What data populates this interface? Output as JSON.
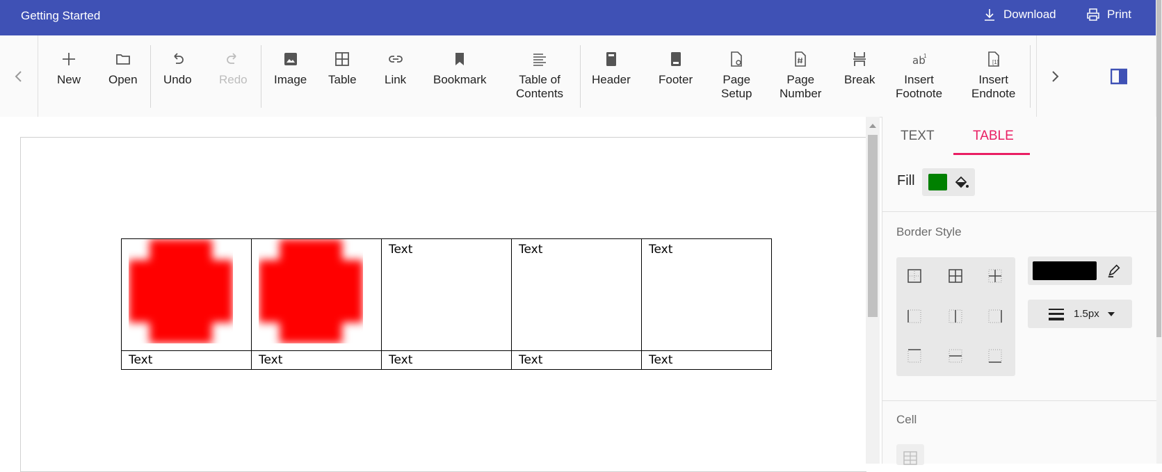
{
  "app": {
    "title": "Getting Started",
    "download_label": "Download",
    "print_label": "Print"
  },
  "toolbar": {
    "items": [
      {
        "label": "New",
        "icon": "plus-icon",
        "disabled": false
      },
      {
        "label": "Open",
        "icon": "folder-icon",
        "disabled": false
      },
      {
        "label": "Undo",
        "icon": "undo-icon",
        "disabled": false
      },
      {
        "label": "Redo",
        "icon": "redo-icon",
        "disabled": true
      },
      {
        "label": "Image",
        "icon": "image-icon",
        "disabled": false
      },
      {
        "label": "Table",
        "icon": "table-icon",
        "disabled": false
      },
      {
        "label": "Link",
        "icon": "link-icon",
        "disabled": false
      },
      {
        "label": "Bookmark",
        "icon": "bookmark-icon",
        "disabled": false
      },
      {
        "label": "Table of\nContents",
        "icon": "toc-icon",
        "disabled": false
      },
      {
        "label": "Header",
        "icon": "header-icon",
        "disabled": false
      },
      {
        "label": "Footer",
        "icon": "footer-icon",
        "disabled": false
      },
      {
        "label": "Page\nSetup",
        "icon": "page-setup-icon",
        "disabled": false
      },
      {
        "label": "Page\nNumber",
        "icon": "page-number-icon",
        "disabled": false
      },
      {
        "label": "Break",
        "icon": "break-icon",
        "disabled": false
      },
      {
        "label": "Insert\nFootnote",
        "icon": "footnote-icon",
        "disabled": false
      },
      {
        "label": "Insert\nEndnote",
        "icon": "endnote-icon",
        "disabled": false
      }
    ]
  },
  "document": {
    "table": {
      "row1": [
        "",
        "",
        "Text",
        "Text",
        "Text"
      ],
      "row2": [
        "Text",
        "Text",
        "Text",
        "Text",
        "Text"
      ],
      "image_color": "#ff0000"
    }
  },
  "properties": {
    "tabs": {
      "text": "TEXT",
      "table": "TABLE",
      "active": "TABLE"
    },
    "fill_label": "Fill",
    "fill_color": "#008000",
    "border_style_label": "Border Style",
    "border_color": "#000000",
    "border_width": "1.5px",
    "cell_label": "Cell"
  },
  "colors": {
    "titlebar": "#3f51b5",
    "accent": "#e91e63",
    "toolbar_bg": "#fafafa"
  }
}
